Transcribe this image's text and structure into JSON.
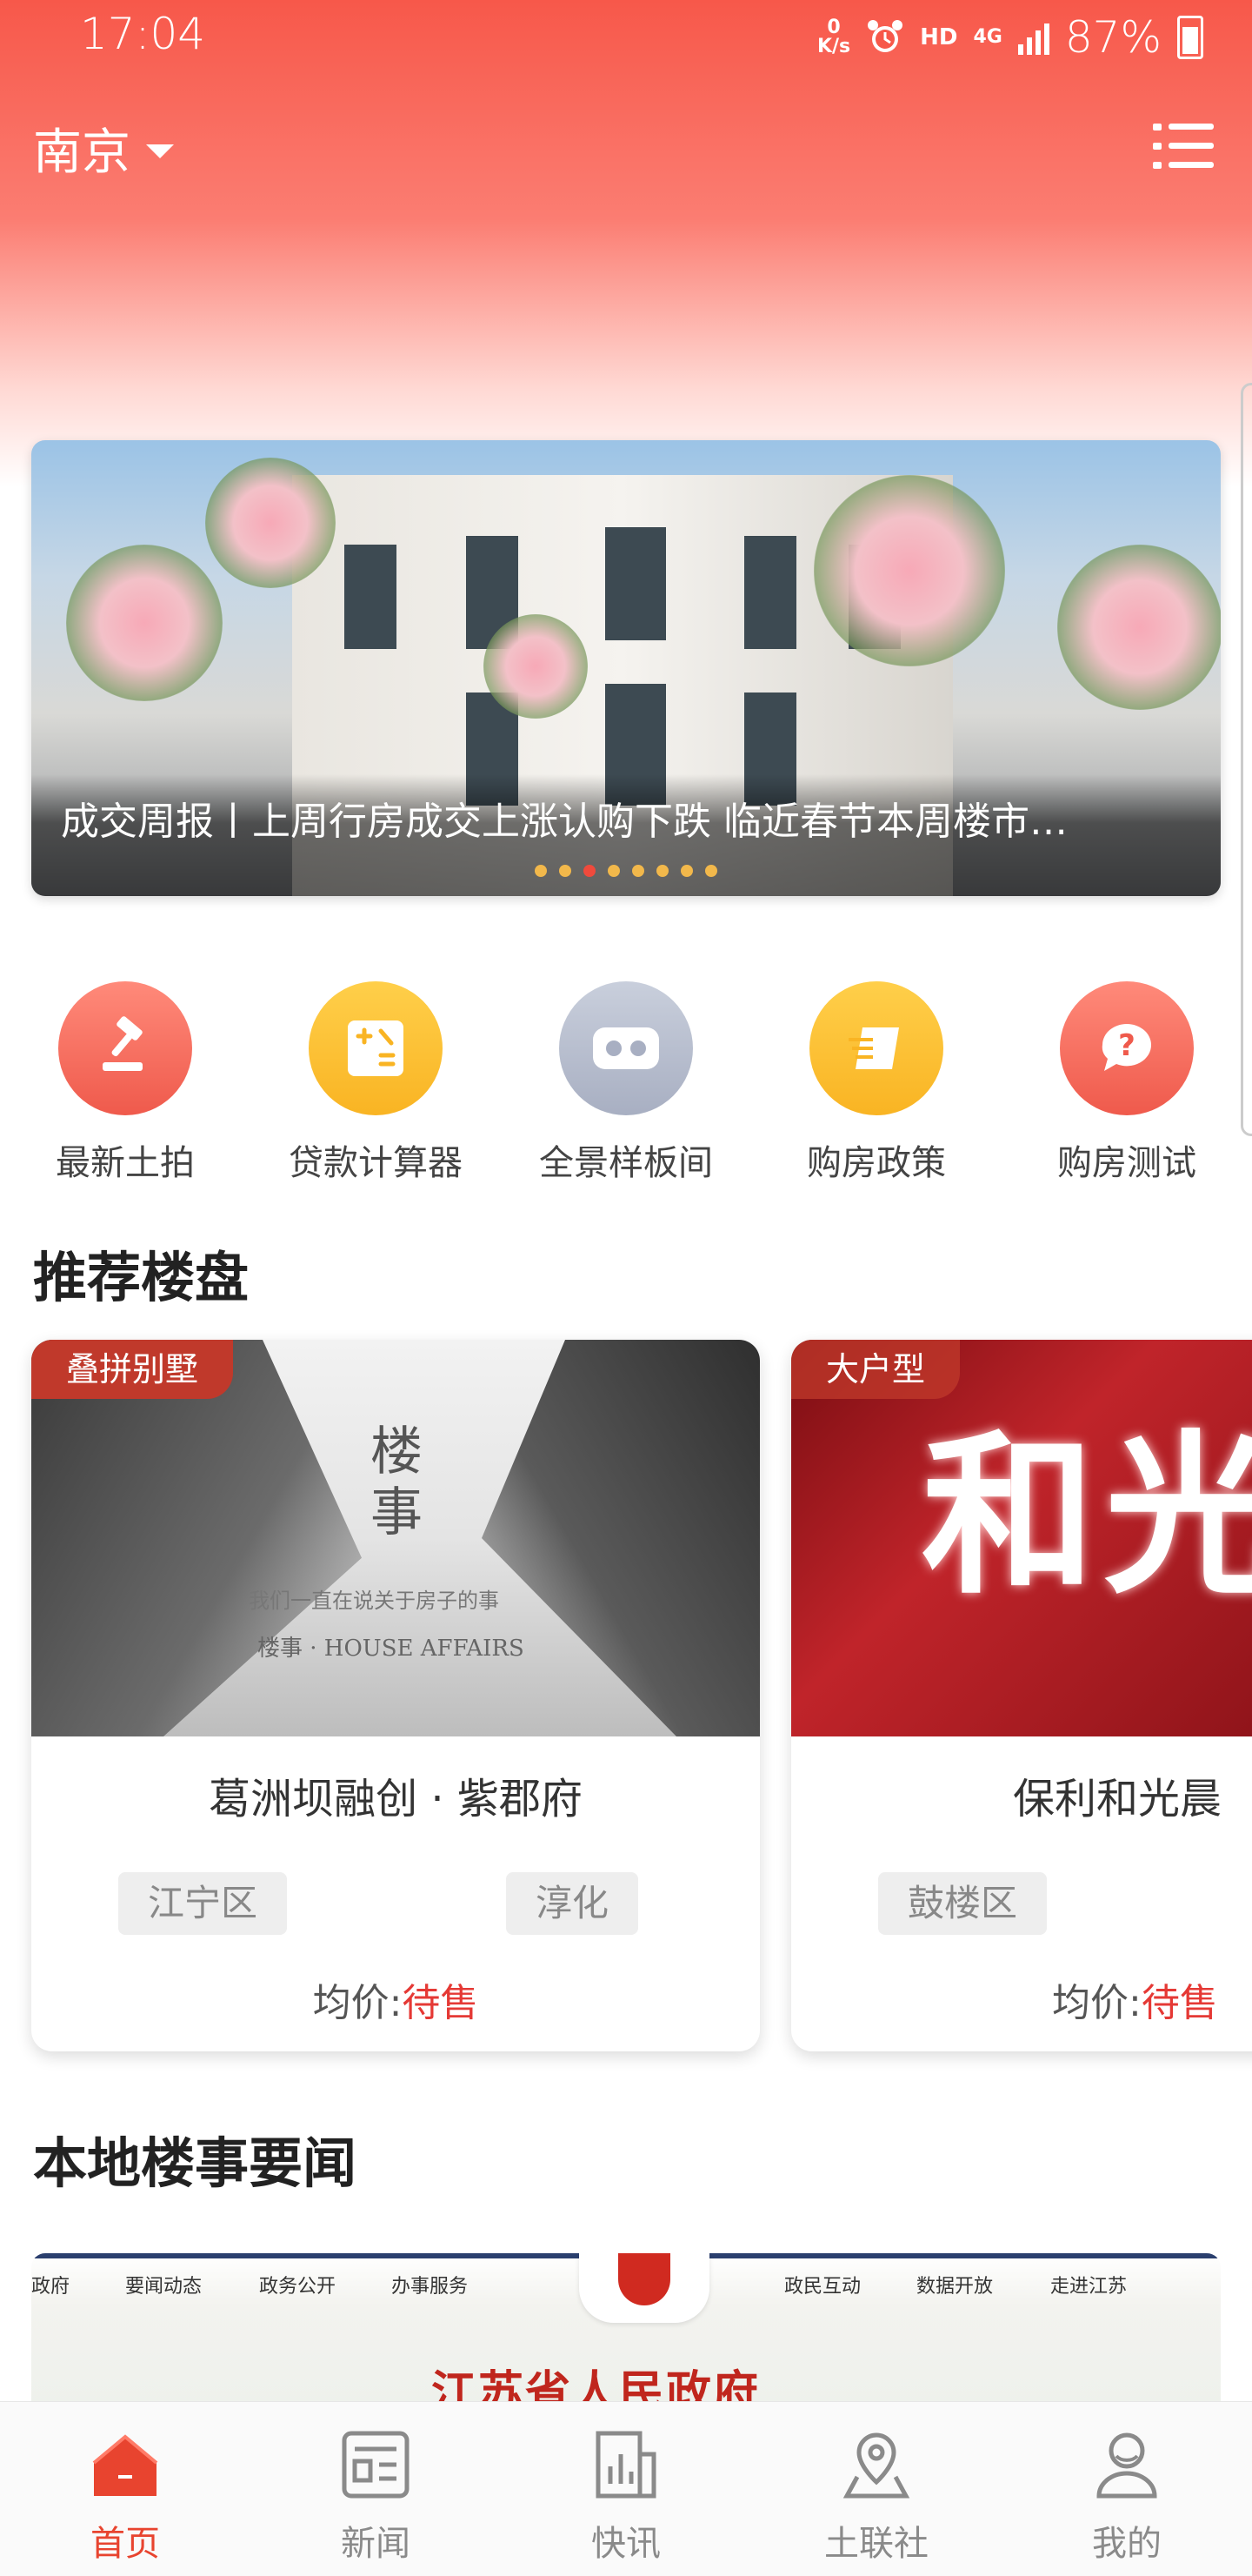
{
  "status_bar": {
    "time": "17:04",
    "net_speed": "0\nK/s",
    "hd": "HD",
    "network": "4G",
    "battery": "87%"
  },
  "header": {
    "city": "南京"
  },
  "banner": {
    "title": "成交周报丨上周行房成交上涨认购下跌 临近春节本周楼市…",
    "dots_count": 8,
    "active_dot": 2
  },
  "quick_actions": [
    {
      "label": "最新土拍",
      "icon": "gavel-icon",
      "color": "#f26a5b"
    },
    {
      "label": "贷款计算器",
      "icon": "calculator-icon",
      "color": "#fbbc33"
    },
    {
      "label": "全景样板间",
      "icon": "vr-headset-icon",
      "color": "#b3b9cb"
    },
    {
      "label": "购房政策",
      "icon": "document-icon",
      "color": "#fbbc33"
    },
    {
      "label": "购房测试",
      "icon": "question-chat-icon",
      "color": "#f26a5b"
    }
  ],
  "recommended": {
    "title": "推荐楼盘",
    "cards": [
      {
        "tag": "叠拼别墅",
        "name": "葛洲坝融创 · 紫郡府",
        "chips": [
          "江宁区",
          "淳化"
        ],
        "price_label": "均价:",
        "price_value": "待售",
        "image_text": {
          "line1": "楼",
          "line2": "事",
          "subtitle": "我们一直在说关于房子的事",
          "brand": "楼事 · HOUSE AFFAIRS"
        }
      },
      {
        "tag": "大户型",
        "name": "保利和光晨",
        "chips": [
          "鼓楼区"
        ],
        "price_label": "均价:",
        "price_value": "待售",
        "image_text": {
          "sign": "和光"
        }
      }
    ]
  },
  "news": {
    "title": "本地楼事要闻",
    "image": {
      "nav_left": [
        "政府",
        "要闻动态",
        "政务公开",
        "办事服务"
      ],
      "nav_right": [
        "政民互动",
        "数据开放",
        "走进江苏"
      ],
      "heading": "江苏省人民政府"
    }
  },
  "tabbar": [
    {
      "label": "首页",
      "icon": "home-icon",
      "active": true
    },
    {
      "label": "新闻",
      "icon": "news-icon",
      "active": false
    },
    {
      "label": "快讯",
      "icon": "flash-news-icon",
      "active": false
    },
    {
      "label": "土联社",
      "icon": "location-pin-icon",
      "active": false
    },
    {
      "label": "我的",
      "icon": "user-icon",
      "active": false
    }
  ],
  "colors": {
    "accent": "#e8442f",
    "header_top": "#f7584a",
    "tag_bg": "#c0392b",
    "price_red": "#e53935"
  }
}
